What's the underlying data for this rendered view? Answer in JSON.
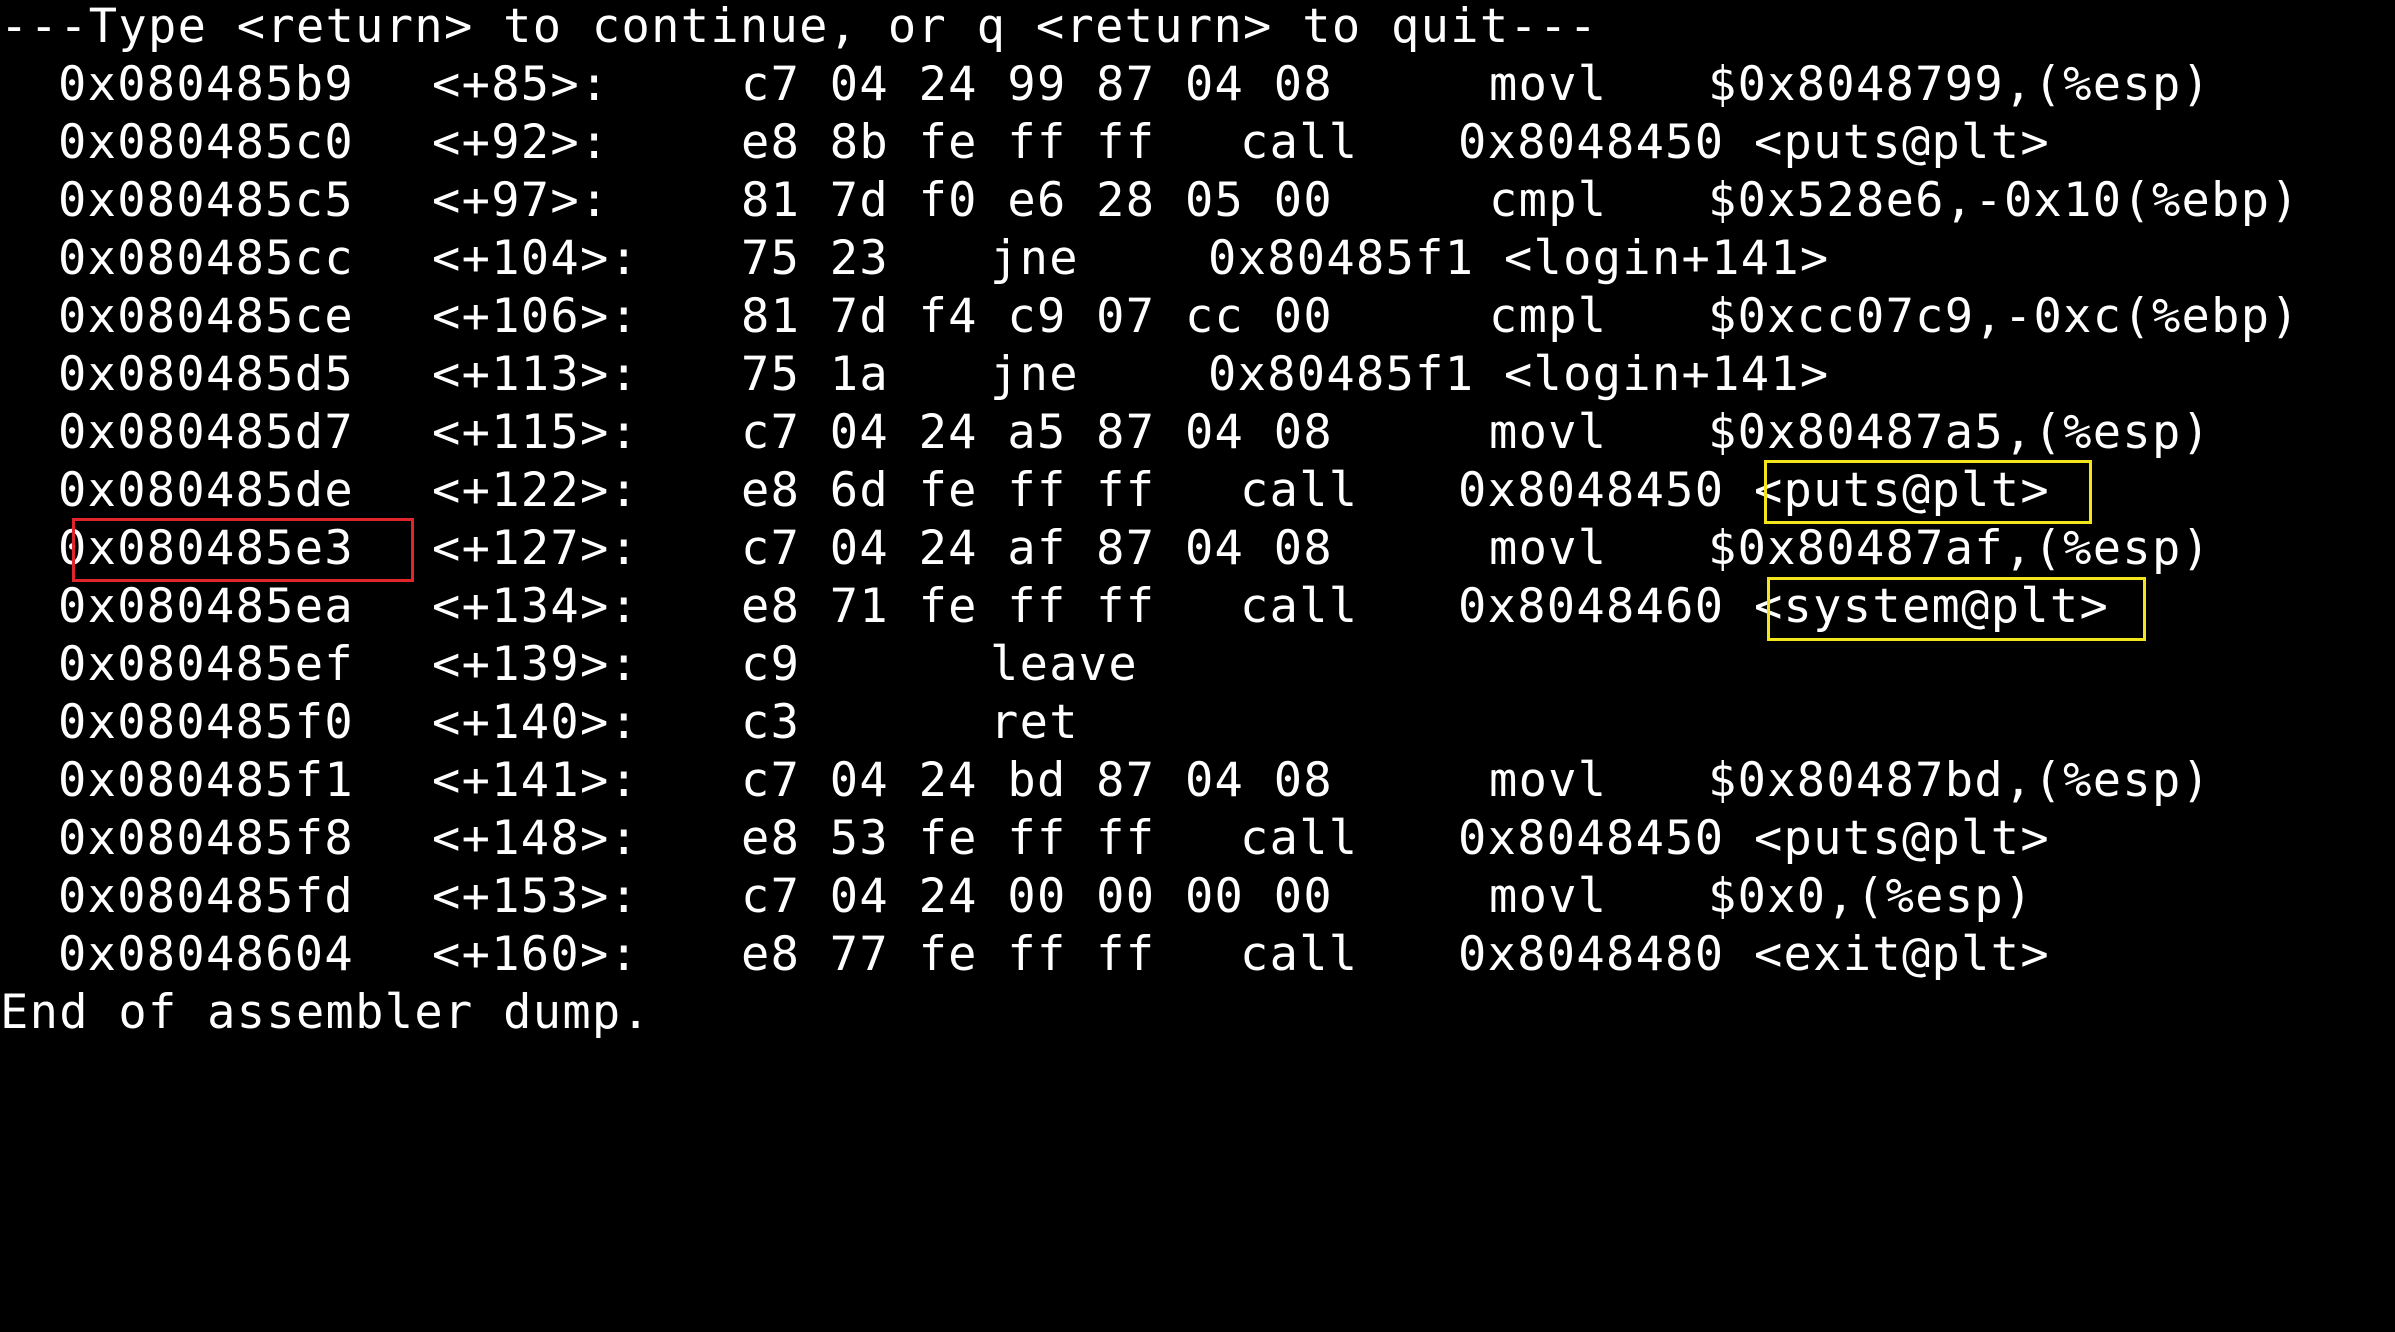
{
  "header": "---Type <return> to continue, or q <return> to quit---",
  "footer": "End of assembler dump.",
  "rows": [
    {
      "addr": "0x080485b9",
      "off": "<+85>:",
      "bytes": "c7 04 24 99 87 04 08",
      "mnem": "movl",
      "ops": "$0x8048799,(%esp)"
    },
    {
      "addr": "0x080485c0",
      "off": "<+92>:",
      "bytes": "e8 8b fe ff ff",
      "mnem": "call",
      "ops": "0x8048450 <puts@plt>"
    },
    {
      "addr": "0x080485c5",
      "off": "<+97>:",
      "bytes": "81 7d f0 e6 28 05 00",
      "mnem": "cmpl",
      "ops": "$0x528e6,-0x10(%ebp)"
    },
    {
      "addr": "0x080485cc",
      "off": "<+104>:",
      "bytes": "75 23",
      "mnem": "jne",
      "ops": "0x80485f1 <login+141>"
    },
    {
      "addr": "0x080485ce",
      "off": "<+106>:",
      "bytes": "81 7d f4 c9 07 cc 00",
      "mnem": "cmpl",
      "ops": "$0xcc07c9,-0xc(%ebp)"
    },
    {
      "addr": "0x080485d5",
      "off": "<+113>:",
      "bytes": "75 1a",
      "mnem": "jne",
      "ops": "0x80485f1 <login+141>"
    },
    {
      "addr": "0x080485d7",
      "off": "<+115>:",
      "bytes": "c7 04 24 a5 87 04 08",
      "mnem": "movl",
      "ops": "$0x80487a5,(%esp)"
    },
    {
      "addr": "0x080485de",
      "off": "<+122>:",
      "bytes": "e8 6d fe ff ff",
      "mnem": "call",
      "ops": "0x8048450 <puts@plt>"
    },
    {
      "addr": "0x080485e3",
      "off": "<+127>:",
      "bytes": "c7 04 24 af 87 04 08",
      "mnem": "movl",
      "ops": "$0x80487af,(%esp)"
    },
    {
      "addr": "0x080485ea",
      "off": "<+134>:",
      "bytes": "e8 71 fe ff ff",
      "mnem": "call",
      "ops": "0x8048460 <system@plt>"
    },
    {
      "addr": "0x080485ef",
      "off": "<+139>:",
      "bytes": "c9",
      "mnem": "leave",
      "ops": ""
    },
    {
      "addr": "0x080485f0",
      "off": "<+140>:",
      "bytes": "c3",
      "mnem": "ret",
      "ops": ""
    },
    {
      "addr": "0x080485f1",
      "off": "<+141>:",
      "bytes": "c7 04 24 bd 87 04 08",
      "mnem": "movl",
      "ops": "$0x80487bd,(%esp)"
    },
    {
      "addr": "0x080485f8",
      "off": "<+148>:",
      "bytes": "e8 53 fe ff ff",
      "mnem": "call",
      "ops": "0x8048450 <puts@plt>"
    },
    {
      "addr": "0x080485fd",
      "off": "<+153>:",
      "bytes": "c7 04 24 00 00 00 00",
      "mnem": "movl",
      "ops": "$0x0,(%esp)"
    },
    {
      "addr": "0x08048604",
      "off": "<+160>:",
      "bytes": "e8 77 fe ff ff",
      "mnem": "call",
      "ops": "0x8048480 <exit@plt>"
    }
  ],
  "highlights": {
    "red_color": "#e0262b",
    "yellow_color": "#f2e51c"
  }
}
